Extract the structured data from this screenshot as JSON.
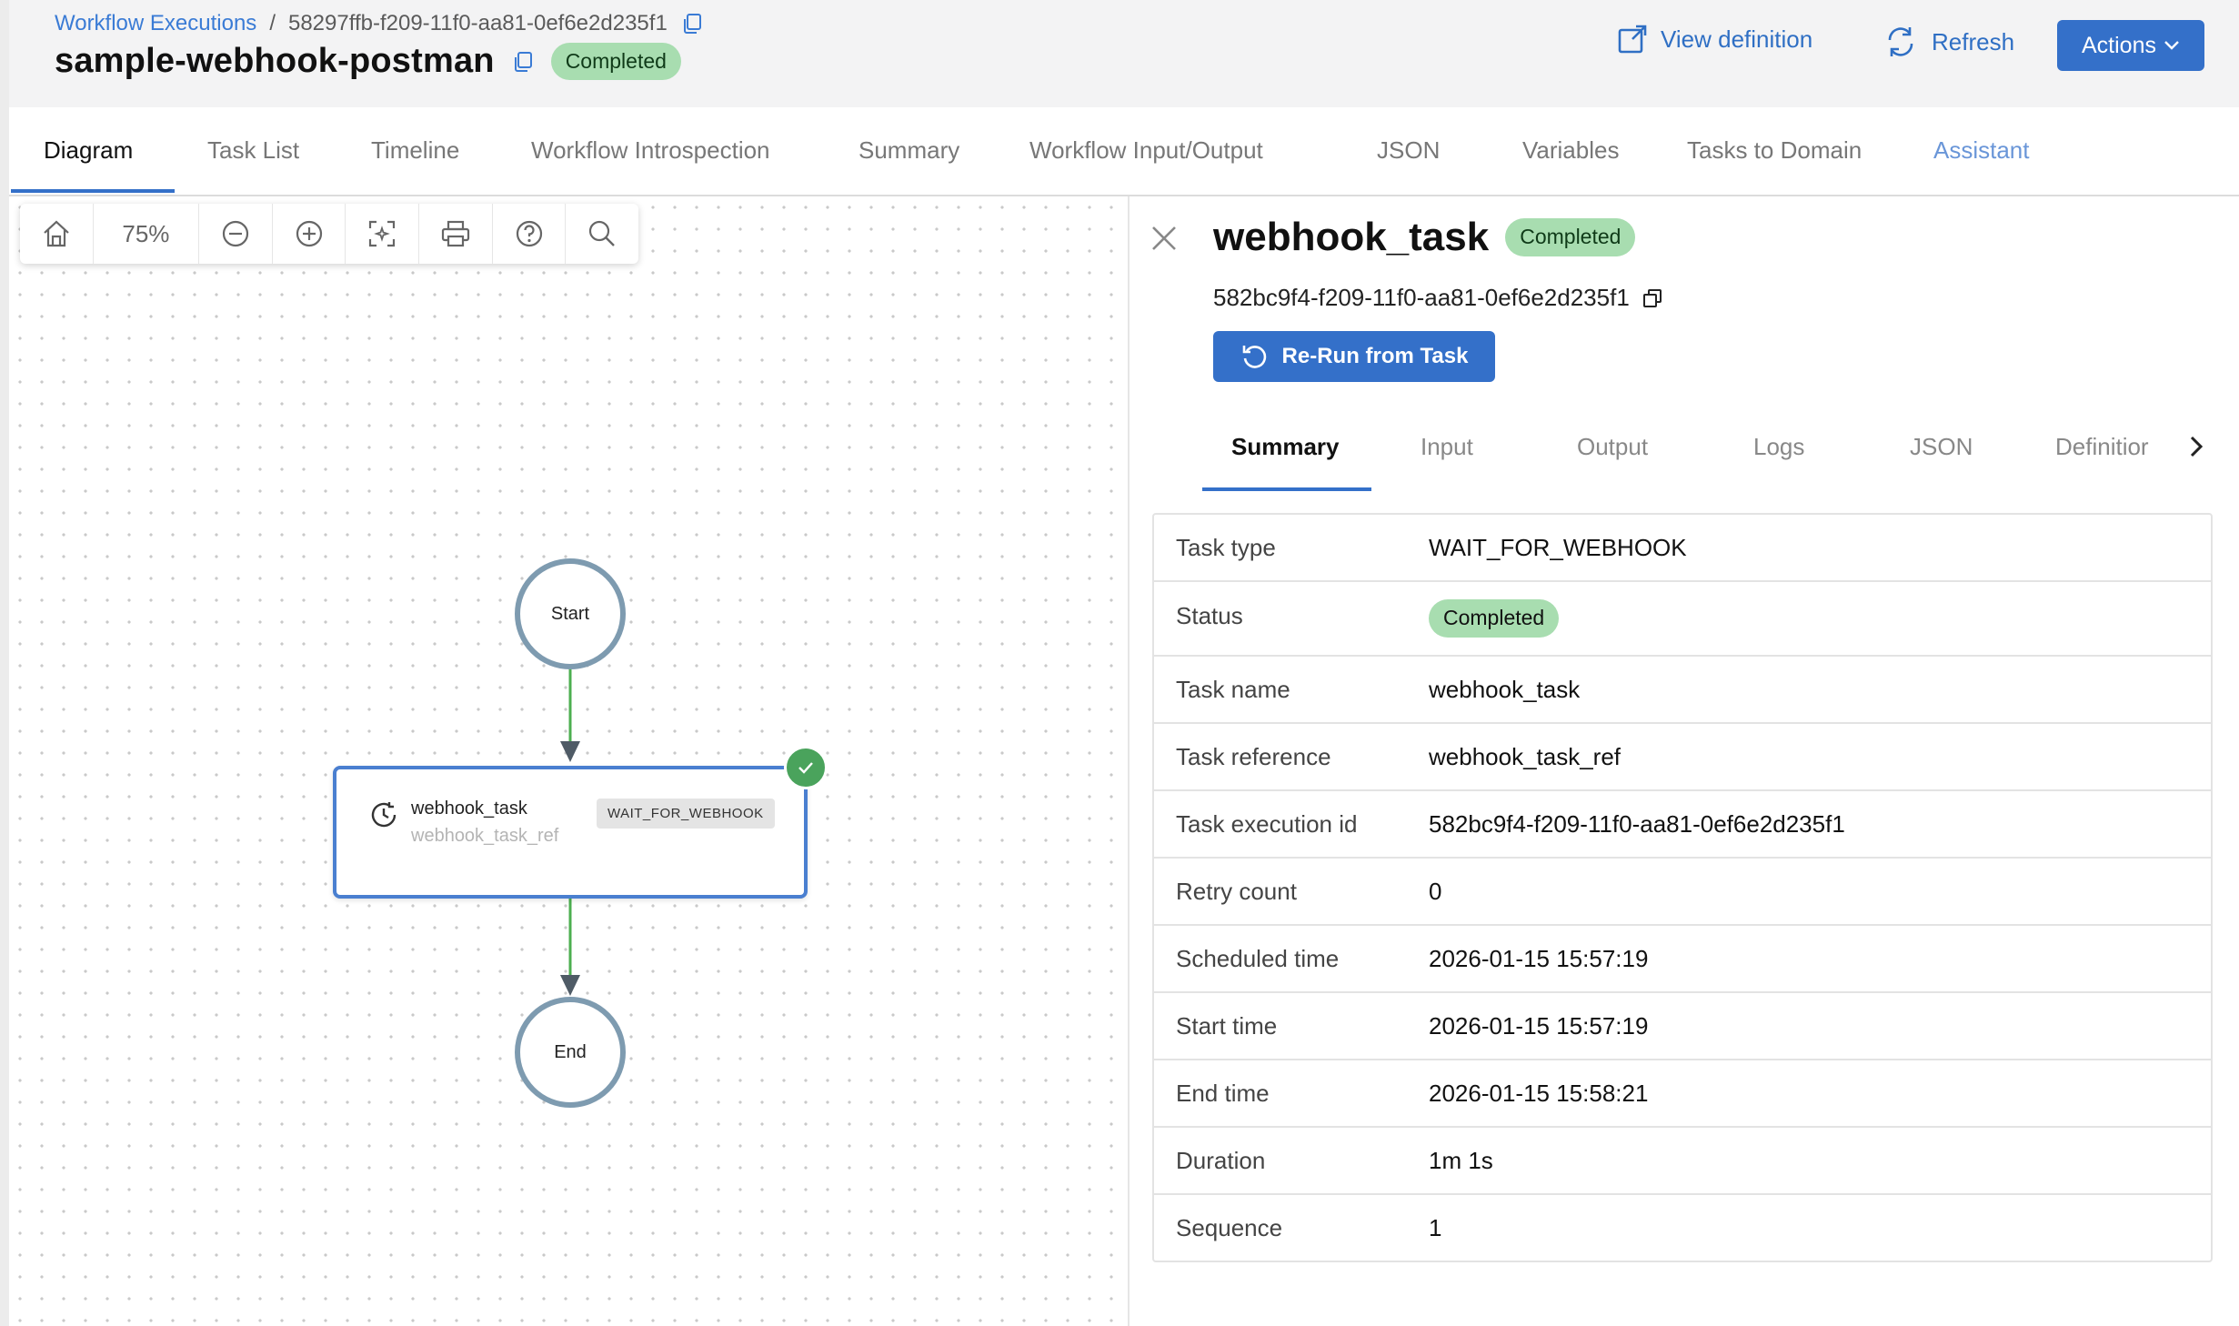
{
  "breadcrumb": {
    "parent": "Workflow Executions",
    "separator": "/",
    "execution_id": "58297ffb-f209-11f0-aa81-0ef6e2d235f1"
  },
  "workflow": {
    "name": "sample-webhook-postman",
    "status": "Completed"
  },
  "header_actions": {
    "view_definition": "View definition",
    "refresh": "Refresh",
    "actions": "Actions"
  },
  "tabs": [
    {
      "label": "Diagram",
      "active": true
    },
    {
      "label": "Task List"
    },
    {
      "label": "Timeline"
    },
    {
      "label": "Workflow Introspection"
    },
    {
      "label": "Summary"
    },
    {
      "label": "Workflow Input/Output"
    },
    {
      "label": "JSON"
    },
    {
      "label": "Variables"
    },
    {
      "label": "Tasks to Domain"
    },
    {
      "label": "Assistant"
    }
  ],
  "toolbar": {
    "zoom": "75%",
    "icons": [
      "home-icon",
      "zoom-out-icon",
      "zoom-in-icon",
      "fit-view-icon",
      "print-icon",
      "help-icon",
      "search-icon"
    ]
  },
  "graph": {
    "start_label": "Start",
    "end_label": "End",
    "task": {
      "name": "webhook_task",
      "ref": "webhook_task_ref",
      "type": "WAIT_FOR_WEBHOOK",
      "status_color": "#4aa35c"
    },
    "edge_color": "#4caf50"
  },
  "task_panel": {
    "title": "webhook_task",
    "status": "Completed",
    "execution_id": "582bc9f4-f209-11f0-aa81-0ef6e2d235f1",
    "rerun_label": "Re-Run from Task",
    "tabs": [
      "Summary",
      "Input",
      "Output",
      "Logs",
      "JSON",
      "Definitior"
    ],
    "details": [
      {
        "key": "Task type",
        "value": "WAIT_FOR_WEBHOOK"
      },
      {
        "key": "Status",
        "value": "Completed",
        "pill": true
      },
      {
        "key": "Task name",
        "value": "webhook_task"
      },
      {
        "key": "Task reference",
        "value": "webhook_task_ref"
      },
      {
        "key": "Task execution id",
        "value": "582bc9f4-f209-11f0-aa81-0ef6e2d235f1"
      },
      {
        "key": "Retry count",
        "value": "0"
      },
      {
        "key": "Scheduled time",
        "value": "2026-01-15 15:57:19"
      },
      {
        "key": "Start time",
        "value": "2026-01-15 15:57:19"
      },
      {
        "key": "End time",
        "value": "2026-01-15 15:58:21"
      },
      {
        "key": "Duration",
        "value": "1m 1s"
      },
      {
        "key": "Sequence",
        "value": "1"
      }
    ]
  },
  "colors": {
    "accent": "#3470c9",
    "success_pill": "#a8ddb0",
    "link": "#3a7bd5"
  }
}
